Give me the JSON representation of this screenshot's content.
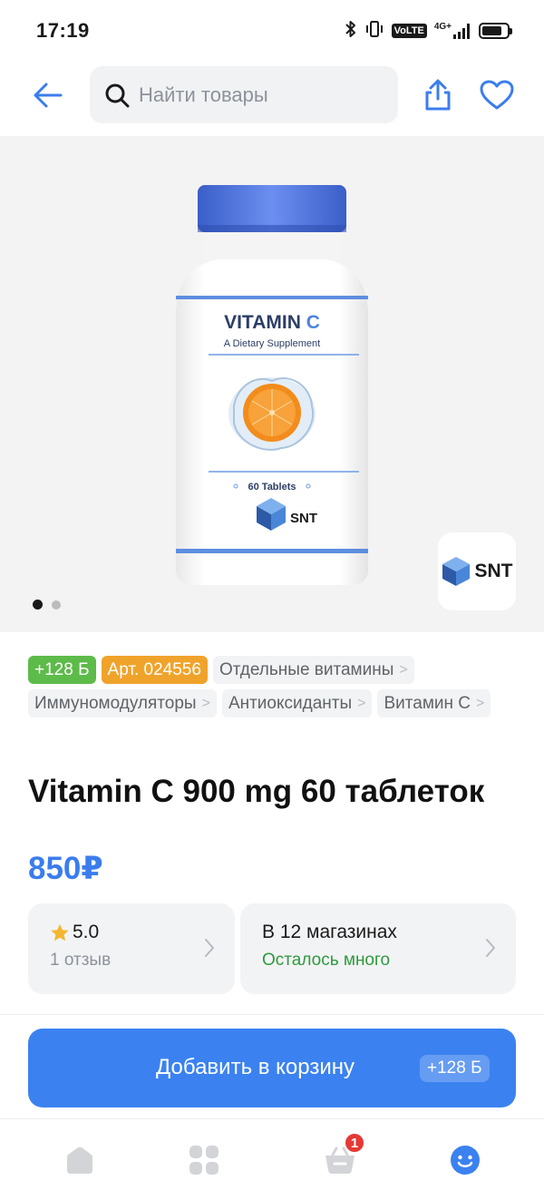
{
  "status_bar": {
    "time": "17:19",
    "volte": "VoLTE",
    "network": "4G+",
    "icons": [
      "bluetooth-icon",
      "vibrate-icon",
      "volte-icon",
      "signal-icon",
      "battery-icon"
    ],
    "battery_level": 0.8
  },
  "top_bar": {
    "search_placeholder": "Найти товары",
    "icons": [
      "back-arrow-icon",
      "search-icon",
      "share-icon",
      "heart-icon"
    ]
  },
  "gallery": {
    "bottle": {
      "title_main": "VITAMIN",
      "title_accent": "C",
      "subtitle": "A Dietary Supplement",
      "count": "60 Tablets",
      "brand": "SNT"
    },
    "brand_badge": "SNT",
    "image_count": 2,
    "active_image": 1
  },
  "tags": {
    "bonus": "+128 Б",
    "article": "Арт. 024556",
    "categories": [
      {
        "label": "Отдельные витамины"
      },
      {
        "label": "Иммуномодуляторы"
      },
      {
        "label": "Антиоксиданты"
      },
      {
        "label": "Витамин С"
      }
    ]
  },
  "product": {
    "title": "Vitamin C 900 mg 60 таблеток",
    "price": "850₽"
  },
  "rating_card": {
    "rating": "5.0",
    "reviews": "1 отзыв"
  },
  "stores_card": {
    "stores": "В 12 магазинах",
    "availability": "Осталось много"
  },
  "cart_button": {
    "label": "Добавить в корзину",
    "bonus": "+128 Б"
  },
  "bottom_nav": {
    "items": [
      "home-icon",
      "catalog-icon",
      "cart-icon",
      "profile-icon"
    ],
    "cart_count": "1"
  },
  "colors": {
    "accent": "#3b82f0",
    "price": "#3b7ded",
    "bonus_tag": "#5dbb4a",
    "article_tag": "#f0a32b",
    "in_stock": "#2f9a3d",
    "badge": "#e53935"
  }
}
